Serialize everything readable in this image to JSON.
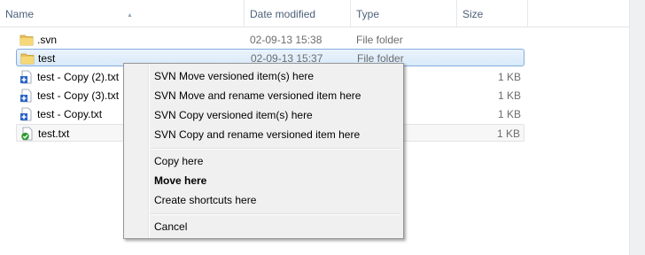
{
  "columns": {
    "name": "Name",
    "date_modified": "Date modified",
    "type": "Type",
    "size": "Size"
  },
  "files": [
    {
      "name": ".svn",
      "date": "02-09-13 15:38",
      "type": "File folder",
      "size": "",
      "icon": "folder-icon"
    },
    {
      "name": "test",
      "date": "02-09-13 15:37",
      "type": "File folder",
      "size": "",
      "icon": "folder-icon",
      "selected": true
    },
    {
      "name": "test - Copy (2).txt",
      "date": "",
      "type": "ment",
      "size": "1 KB",
      "icon": "svn-added-file-icon"
    },
    {
      "name": "test - Copy (3).txt",
      "date": "",
      "type": "ment",
      "size": "1 KB",
      "icon": "svn-added-file-icon"
    },
    {
      "name": "test - Copy.txt",
      "date": "",
      "type": "ment",
      "size": "1 KB",
      "icon": "svn-added-file-icon"
    },
    {
      "name": "test.txt",
      "date": "",
      "type": "ment",
      "size": "1 KB",
      "icon": "svn-normal-file-icon"
    }
  ],
  "context_menu": {
    "svn_move": "SVN Move versioned item(s) here",
    "svn_move_rename": "SVN Move and rename versioned item here",
    "svn_copy": "SVN Copy versioned item(s) here",
    "svn_copy_rename": "SVN Copy and rename versioned item here",
    "copy_here": "Copy here",
    "move_here": "Move here",
    "create_shortcuts": "Create shortcuts here",
    "cancel": "Cancel"
  },
  "colors": {
    "header_text": "#4c607a",
    "selection_border": "#84acdd",
    "menu_background": "#f0f0f0"
  }
}
